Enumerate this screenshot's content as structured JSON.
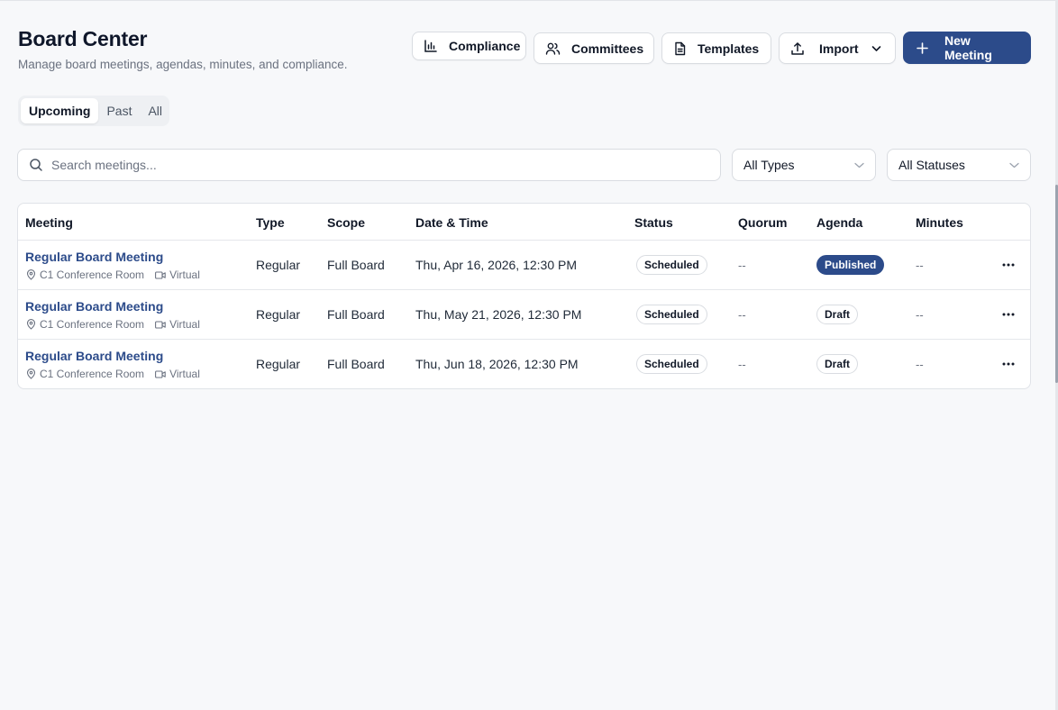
{
  "header": {
    "title": "Board Center",
    "subtitle": "Manage board meetings, agendas, minutes, and compliance."
  },
  "toolbar": {
    "compliance_label": "Compliance",
    "committees_label": "Committees",
    "templates_label": "Templates",
    "import_label": "Import",
    "new_meeting_label": "New Meeting"
  },
  "tabs": [
    {
      "label": "Upcoming",
      "active": true
    },
    {
      "label": "Past",
      "active": false
    },
    {
      "label": "All",
      "active": false
    }
  ],
  "search": {
    "placeholder": "Search meetings...",
    "value": ""
  },
  "filters": {
    "type": "All Types",
    "status": "All Statuses"
  },
  "table": {
    "columns": [
      "Meeting",
      "Type",
      "Scope",
      "Date & Time",
      "Status",
      "Quorum",
      "Agenda",
      "Minutes"
    ],
    "rows": [
      {
        "meeting": "Regular Board Meeting",
        "location": "C1 Conference Room",
        "mode": "Virtual",
        "type": "Regular",
        "scope": "Full Board",
        "datetime": "Thu, Apr 16, 2026, 12:30 PM",
        "status": "Scheduled",
        "quorum": "--",
        "agenda": "Published",
        "minutes": "--"
      },
      {
        "meeting": "Regular Board Meeting",
        "location": "C1 Conference Room",
        "mode": "Virtual",
        "type": "Regular",
        "scope": "Full Board",
        "datetime": "Thu, May 21, 2026, 12:30 PM",
        "status": "Scheduled",
        "quorum": "--",
        "agenda": "Draft",
        "minutes": "--"
      },
      {
        "meeting": "Regular Board Meeting",
        "location": "C1 Conference Room",
        "mode": "Virtual",
        "type": "Regular",
        "scope": "Full Board",
        "datetime": "Thu, Jun 18, 2026, 12:30 PM",
        "status": "Scheduled",
        "quorum": "--",
        "agenda": "Draft",
        "minutes": "--"
      }
    ]
  },
  "colors": {
    "accent": "#2c4b8a",
    "background": "#f7f8fa",
    "border": "#d9dce1",
    "muted_text": "#6b7280"
  },
  "icons": {
    "compliance": "bar-chart-icon",
    "committees": "users-icon",
    "templates": "file-text-icon",
    "import": "upload-icon",
    "import_menu": "chevron-down-icon",
    "new_meeting": "plus-icon",
    "search": "search-icon",
    "select": "chevron-down-icon",
    "location": "map-pin-icon",
    "virtual": "video-icon",
    "row_actions": "more-horizontal-icon"
  }
}
